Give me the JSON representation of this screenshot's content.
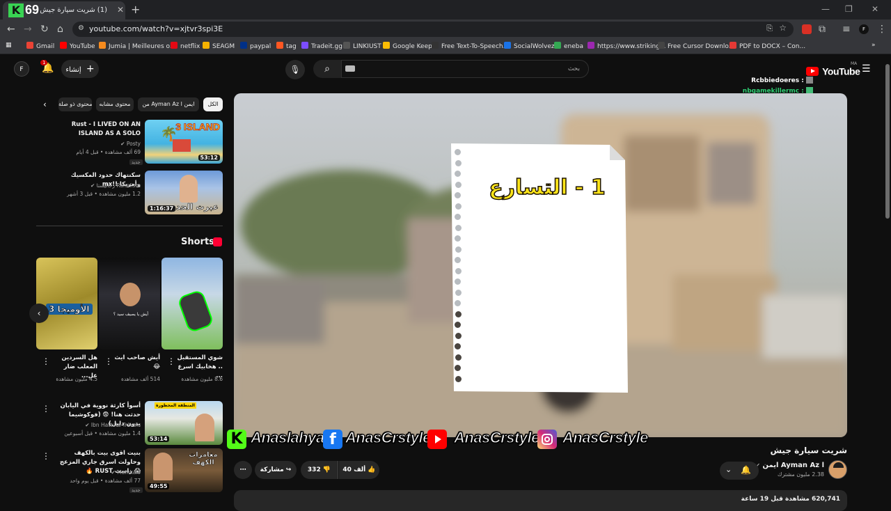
{
  "browser": {
    "tab_number": "69",
    "tab_title": "(1) شريت سيارة جيش - YouTube",
    "url": "youtube.com/watch?v=xjtvr3spi3E",
    "bookmarks": [
      {
        "label": "Gmail",
        "color": "#ea4335"
      },
      {
        "label": "YouTube",
        "color": "#ff0000"
      },
      {
        "label": "Jumia | Meilleures o...",
        "color": "#f68b1e"
      },
      {
        "label": "netflix",
        "color": "#e50914"
      },
      {
        "label": "SEAGM",
        "color": "#f5b301"
      },
      {
        "label": "paypal",
        "color": "#003087"
      },
      {
        "label": "tag",
        "color": "#ff5722"
      },
      {
        "label": "Tradeit.gg",
        "color": "#7c4dff"
      },
      {
        "label": "LINKIUST",
        "color": "#555555"
      },
      {
        "label": "Google Keep",
        "color": "#fbbc04"
      },
      {
        "label": "Free Text-To-Speech...",
        "color": "#333333"
      },
      {
        "label": "SocialWolvez",
        "color": "#1a73e8"
      },
      {
        "label": "eneba",
        "color": "#34a853"
      },
      {
        "label": "https://www.striking...",
        "color": "#9c27b0"
      },
      {
        "label": "Free Cursor Downlo...",
        "color": "#444444"
      },
      {
        "label": "PDF to DOCX – Con...",
        "color": "#e53935"
      }
    ]
  },
  "header": {
    "avatar_letter": "F",
    "notif_count": "1",
    "create_label": "إنشاء",
    "search_placeholder": "بحث",
    "logo_text": "YouTube",
    "logo_region": "MA"
  },
  "chat": [
    {
      "user": "Rcbbiedoeres :",
      "color": "#ffffff"
    },
    {
      "user": "nbgamekillermc :",
      "color": "#2ecc71"
    }
  ],
  "chips": [
    "الكل",
    "من Ayman Az l ايمن",
    "محتوى مشابه",
    "محتوى ذو صلة"
  ],
  "related": [
    {
      "title": "Rust - I LIVED ON AN ISLAND AS A SOLO",
      "channel": "Posty",
      "meta": "69 ألف مشاهدة • قبل 4 أيام",
      "badge": "جديد",
      "duration": "53:12",
      "thumb_text": "3 ISLAND"
    },
    {
      "title": "سكنتهاك حدود المكسيك وأمريكا !!mx",
      "channel": "Rahalista رحاليستا",
      "meta": "1.2 مليون مشاهدة • قبل 3 أشهر",
      "badge": "",
      "duration": "1:16:37",
      "thumb_text": "عبرت الحدود"
    },
    {
      "title": "أسوأ كارثة نووية في اليابان حدثت هنا! 😨 (فوكوشيما بدون دليل)",
      "channel": "Ibn Hattuta Travels",
      "meta": "1.4 مليون مشاهدة • قبل أسبوعين",
      "badge": "",
      "duration": "53:14",
      "thumb_text": "المنطقة المحظورة"
    },
    {
      "title": "بنيت اقوى بيت بالكهف وحاولت اسرق جاري المزعج 😱 راست RUST 🔥",
      "channel": "Mamkalo",
      "meta": "77 ألف مشاهدة • قبل يوم واحد",
      "badge": "جديد",
      "duration": "49:55",
      "thumb_text": "مغامرات الكهف"
    }
  ],
  "shorts_heading": "Shorts",
  "shorts": [
    {
      "title": "هل السردين المعلب ضار عل...",
      "views": "4.5 مليون مشاهدة",
      "thumb_text": "الأوميجا 3"
    },
    {
      "title": "أيش صاحب ايث 😂",
      "views": "514 ألف مشاهدة",
      "thumb_text": "أيش يا يصيف سيد ؟"
    },
    {
      "title": "شوي المستقبل .. هخابيك اسرع ...",
      "views": "8.6 مليون مشاهدة",
      "thumb_text": ""
    }
  ],
  "video": {
    "title": "شريت سيارة جيش",
    "note_text": "1 - التسارع",
    "channel": "Ayman Az l ايمن",
    "subscribers": "2.38 مليون مشترك",
    "likes": "40 ألف",
    "dislikes": "332",
    "share_label": "مشاركة",
    "views_date": "620,741 مشاهدة قبل 19 ساعة"
  },
  "banner": {
    "items": [
      {
        "platform": "kick-icon",
        "handle": "Anaslahya"
      },
      {
        "platform": "facebook-icon",
        "handle": "AnasCrstyle"
      },
      {
        "platform": "youtube-icon",
        "handle": "AnasCrstyle"
      },
      {
        "platform": "instagram-icon",
        "handle": "AnasCrstyle"
      }
    ]
  }
}
